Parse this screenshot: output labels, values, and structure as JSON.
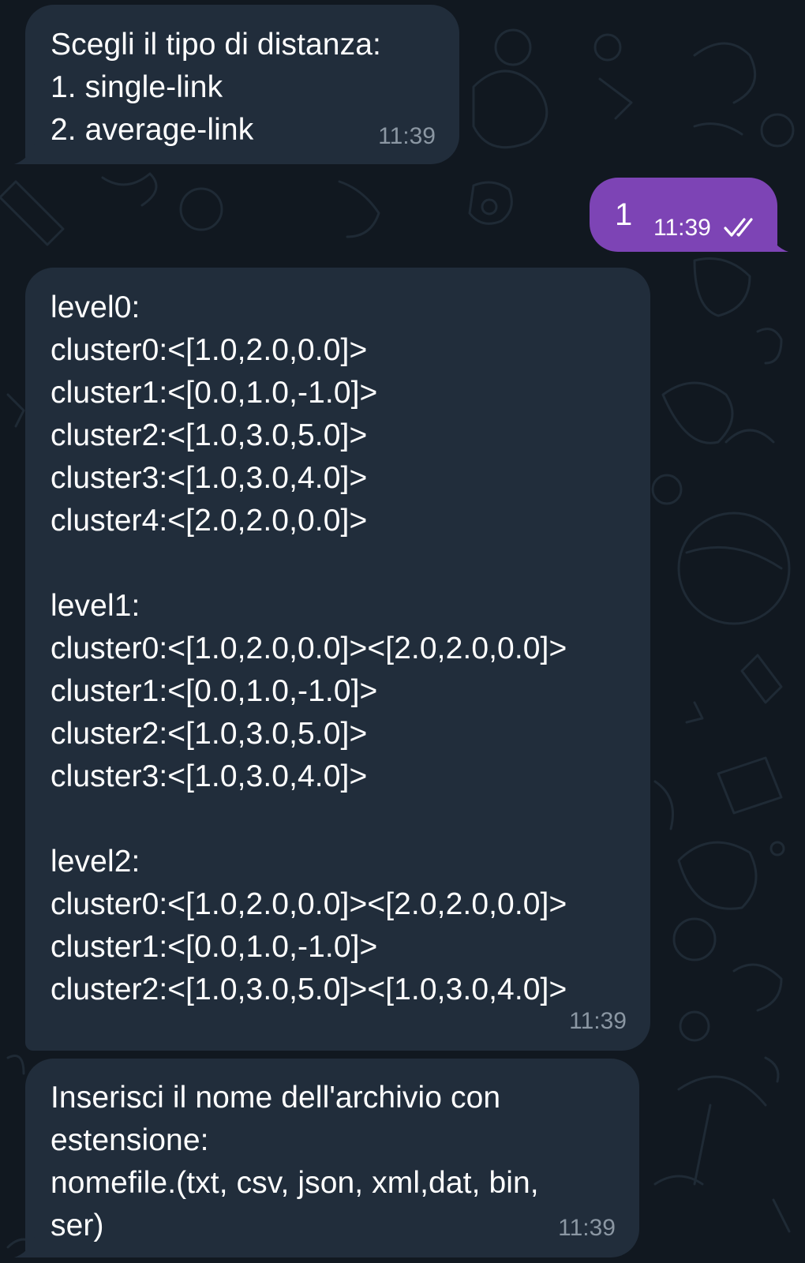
{
  "messages": [
    {
      "direction": "incoming",
      "text": "Scegli il tipo di distanza:\n1. single-link\n2. average-link",
      "time": "11:39"
    },
    {
      "direction": "outgoing",
      "text": "1",
      "time": "11:39",
      "status_icon": "double-check-icon"
    },
    {
      "direction": "incoming",
      "text": "level0:\ncluster0:<[1.0,2.0,0.0]>\ncluster1:<[0.0,1.0,-1.0]>\ncluster2:<[1.0,3.0,5.0]>\ncluster3:<[1.0,3.0,4.0]>\ncluster4:<[2.0,2.0,0.0]>\n\nlevel1:\ncluster0:<[1.0,2.0,0.0]><[2.0,2.0,0.0]>\ncluster1:<[0.0,1.0,-1.0]>\ncluster2:<[1.0,3.0,5.0]>\ncluster3:<[1.0,3.0,4.0]>\n\nlevel2:\ncluster0:<[1.0,2.0,0.0]><[2.0,2.0,0.0]>\ncluster1:<[0.0,1.0,-1.0]>\ncluster2:<[1.0,3.0,5.0]><[1.0,3.0,4.0]>",
      "time": "11:39"
    },
    {
      "direction": "incoming",
      "text": "Inserisci il nome dell'archivio con\nestensione:\nnomefile.(txt, csv, json, xml,dat, bin,\nser)",
      "time": "11:39"
    }
  ],
  "colors": {
    "background": "#111820",
    "incoming_bubble": "#212d3b",
    "outgoing_bubble": "#7d44b5",
    "timestamp": "#8b97a3",
    "text": "#ffffff"
  }
}
